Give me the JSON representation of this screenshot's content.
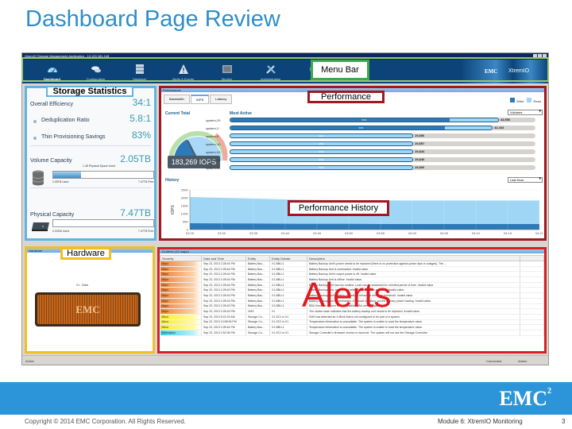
{
  "slide": {
    "title": "Dashboard Page Review",
    "copyright": "Copyright © 2014 EMC Corporation. All Rights Reserved.",
    "module": "Module 6: XtremIO Monitoring",
    "page_number": "3",
    "footer_logo": "EMC",
    "footer_logo_sup": "2"
  },
  "app": {
    "window_title": "XtremIO Storage Management Application - 10.120.181.146",
    "brand_emc": "EMC",
    "brand_product": "XtremIO",
    "menu": [
      {
        "label": "Dashboard",
        "icon": "dashboard-gauge-icon",
        "active": true
      },
      {
        "label": "Configuration",
        "icon": "disks-icon",
        "active": false
      },
      {
        "label": "Hardware",
        "icon": "server-rack-icon",
        "active": false
      },
      {
        "label": "Alerts & Events",
        "icon": "warning-triangle-icon",
        "active": false
      },
      {
        "label": "Monitor",
        "icon": "monitor-icon",
        "active": false
      },
      {
        "label": "Administration",
        "icon": "tools-icon",
        "active": false
      },
      {
        "label": "About",
        "icon": "help-icon",
        "active": false
      }
    ],
    "status_left": "Active",
    "status_right_1": "Connected",
    "status_right_2": "Admin"
  },
  "callouts": {
    "menu_bar": "Menu Bar",
    "storage_statistics": "Storage Statistics",
    "performance": "Performance",
    "performance_history": "Performance History",
    "hardware": "Hardware",
    "alerts": "Alerts"
  },
  "storage": {
    "overall_efficiency_label": "Overall Efficiency",
    "overall_efficiency_value": "34:1",
    "dedup_label": "Deduplication Ratio",
    "dedup_value": "5.8:1",
    "thin_label": "Thin Provisioning Savings",
    "thin_value": "83%",
    "volume_capacity_label": "Volume Capacity",
    "volume_capacity_value": "2.05TB",
    "volume_caption": "1.48 Physical Space Used",
    "volume_fill_fraction": 0.28,
    "volume_min": "2.05TB Used",
    "volume_max": "7.47TB Free",
    "physical_capacity_label": "Physical Capacity",
    "physical_capacity_value": "7.47TB",
    "physical_fill_fraction": 0.0,
    "physical_min": "0.00GB Used",
    "physical_max": "7.47TB Free"
  },
  "performance": {
    "panel_title": "Performance",
    "tabs": [
      {
        "label": "Bandwidth",
        "active": false
      },
      {
        "label": "IOPS",
        "active": true
      },
      {
        "label": "Latency",
        "active": false
      }
    ],
    "current_total_label": "Current Total",
    "current_total_value": "183,269 IOPS",
    "gauge_fraction": 0.35,
    "most_active_label": "Most Active",
    "legend_write": "Write",
    "legend_read": "Read",
    "write_color": "#2e7ab8",
    "read_color": "#9fd6f5",
    "filter_select": "Volumes",
    "systems": [
      {
        "name": "system-29",
        "value": "43,556",
        "fraction": 0.88,
        "write_fraction": 0.82,
        "inner": "50%"
      },
      {
        "name": "system-2..",
        "value": "42,434",
        "fraction": 0.86,
        "write_fraction": 0.82,
        "inner": "50%"
      },
      {
        "name": "system-6",
        "value": "19,856",
        "fraction": 0.6,
        "write_fraction": 0,
        "inner": "28%"
      },
      {
        "name": "system-10",
        "value": "19,857",
        "fraction": 0.6,
        "write_fraction": 0,
        "inner": "28%"
      },
      {
        "name": "system-03",
        "value": "19,844",
        "fraction": 0.6,
        "write_fraction": 0,
        "inner": "50%"
      },
      {
        "name": "system-05",
        "value": "19,840",
        "fraction": 0.6,
        "write_fraction": 0,
        "inner": "50%"
      },
      {
        "name": "system-04",
        "value": "19,800",
        "fraction": 0.6,
        "write_fraction": 0,
        "inner": "50%"
      }
    ]
  },
  "chart_data": {
    "type": "area",
    "title": "History",
    "xlabel": "",
    "ylabel": "IOPS",
    "ylim": [
      0,
      250000
    ],
    "yticks": [
      "0",
      "50K",
      "100K",
      "150K",
      "200K",
      "250K"
    ],
    "x": [
      "03:25",
      "03:30",
      "03:35",
      "03:40",
      "03:45",
      "03:50",
      "03:55",
      "04:00",
      "04:05",
      "04:10",
      "04:15",
      "04:20"
    ],
    "series": [
      {
        "name": "Read",
        "values": [
          205000,
          200000,
          195000,
          190000,
          187000,
          185000,
          184000,
          183000,
          183000,
          183000,
          183000,
          183000
        ]
      },
      {
        "name": "Write",
        "values": [
          40000,
          39000,
          38000,
          37000,
          36000,
          36000,
          35000,
          35000,
          35000,
          35000,
          35000,
          35000
        ]
      }
    ],
    "range_select": "Last Hour",
    "grid": true
  },
  "hardware": {
    "panel_title": "Hardware",
    "brick_label": "X1 - Brick",
    "brick_logo": "EMC"
  },
  "alerts": {
    "panel_title": "13 Alerts (13 major)",
    "columns": [
      "Severity",
      "Date and Time",
      "Entity",
      "Entity Details",
      "Description"
    ],
    "rows": [
      {
        "severity": "Major",
        "sev": "major",
        "time": "Sep 23, 2013 2:28:44 PM",
        "entity": "Battery Bac...",
        "details": "X1-BBU-1",
        "desc": "Battery Backup Unit's power needs to be replaced (there is no protection against power dips or outages). The ..."
      },
      {
        "severity": "Major",
        "sev": "major",
        "time": "Sep 23, 2013 2:28:44 PM",
        "entity": "Battery Bac...",
        "details": "X1-BBU-1",
        "desc": "Battery Backup Unit is overloaded. Invalid value."
      },
      {
        "severity": "Major",
        "sev": "major",
        "time": "Sep 23, 2013 2:28:44 PM",
        "entity": "Battery Bac...",
        "details": "X1-BBU-1",
        "desc": "Battery Backup Unit's output power is off. Invalid value."
      },
      {
        "severity": "Major",
        "sev": "major",
        "time": "Sep 23, 2013 2:28:44 PM",
        "entity": "Battery Bac...",
        "details": "X1-BBU-1",
        "desc": "Battery Backup Unit is offline. Invalid value."
      },
      {
        "severity": "Major",
        "sev": "major",
        "time": "Sep 23, 2013 2:28:44 PM",
        "entity": "Battery Bac...",
        "details": "X1-BBU-1",
        "desc": "Battery Backup Unit has low runtime. Load can be sustained for a limited period of time. Invalid value."
      },
      {
        "severity": "Major",
        "sev": "major",
        "time": "Sep 23, 2013 2:28:43 PM",
        "entity": "Battery Bac...",
        "details": "X1-BBU-1",
        "desc": "Battery Backup Unit, battery test failed; battery needs replacing. Invalid value."
      },
      {
        "severity": "Major",
        "sev": "major",
        "time": "Sep 23, 2013 2:28:43 PM",
        "entity": "Battery Bac...",
        "details": "X1-BBU-1",
        "desc": "Battery Backup Unit's battery capacity is below the minimum threshold. Invalid value."
      },
      {
        "severity": "Major",
        "sev": "major",
        "time": "Sep 23, 2013 2:28:43 PM",
        "entity": "Battery Bac...",
        "details": "X1-BBU-1",
        "desc": "Battery Backup Unit is overloaded. Overload condition; cut the primary power loading. Invalid value."
      },
      {
        "severity": "Major",
        "sev": "major",
        "time": "Sep 23, 2013 2:28:43 PM",
        "entity": "Battery Bac...",
        "details": "X1-BBU-1",
        "desc": "BBU firmware version is incompatible. BBU needs replacing."
      },
      {
        "severity": "Major",
        "sev": "major",
        "time": "Sep 23, 2013 2:28:43 PM",
        "entity": "XMS",
        "details": "X1",
        "desc": "The cluster state indicates that the battery backup unit needs to be replaced. Invalid value."
      },
      {
        "severity": "Minor",
        "sev": "minor",
        "time": "Sep 23, 2013 8:22:23 AM",
        "entity": "Storage Co...",
        "details": "X1-SC1 in X1",
        "desc": "XMS has detected an X-Brick that is not configured to be part of a system."
      },
      {
        "severity": "Minor",
        "sev": "minor",
        "time": "Sep 23, 2013 10:58:36 PM",
        "entity": "Storage Co...",
        "details": "X1-SC2 in X1",
        "desc": "Temperature information is unavailable. The system is unable to read the temperature value."
      },
      {
        "severity": "Minor",
        "sev": "minor",
        "time": "Sep 23, 2013 2:28:44 PM",
        "entity": "Battery Bac...",
        "details": "X1-BBU-1",
        "desc": "Temperature information is unavailable. The system is unable to read the temperature value."
      },
      {
        "severity": "Information",
        "sev": "info",
        "time": "Sep 23, 2013 2:52:36 PM",
        "entity": "Storage Co...",
        "details": "X1-SC1 in X1",
        "desc": "Storage Controller's firmware version is incorrect. The system will not use the Storage Controller."
      }
    ]
  }
}
